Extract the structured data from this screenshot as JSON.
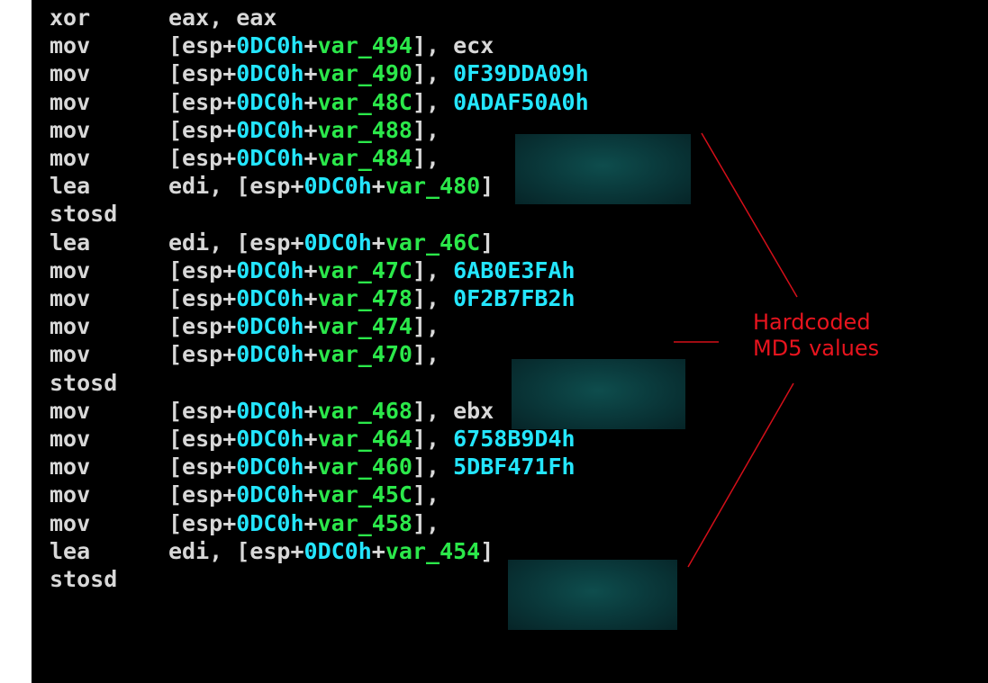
{
  "listing": {
    "lines": [
      {
        "mnemonic": "xor",
        "tokens": [
          {
            "t": "eax, eax",
            "k": "plain"
          }
        ]
      },
      {
        "mnemonic": "mov",
        "tokens": [
          {
            "t": "[esp+",
            "k": "plain"
          },
          {
            "t": "0DC0h",
            "k": "hex"
          },
          {
            "t": "+",
            "k": "plain"
          },
          {
            "t": "var_494",
            "k": "var"
          },
          {
            "t": "], ",
            "k": "plain"
          },
          {
            "t": "ecx",
            "k": "reg"
          }
        ]
      },
      {
        "mnemonic": "mov",
        "tokens": [
          {
            "t": "[esp+",
            "k": "plain"
          },
          {
            "t": "0DC0h",
            "k": "hex"
          },
          {
            "t": "+",
            "k": "plain"
          },
          {
            "t": "var_490",
            "k": "var"
          },
          {
            "t": "], ",
            "k": "plain"
          },
          {
            "t": "0F39DDA09h",
            "k": "imm"
          }
        ]
      },
      {
        "mnemonic": "mov",
        "tokens": [
          {
            "t": "[esp+",
            "k": "plain"
          },
          {
            "t": "0DC0h",
            "k": "hex"
          },
          {
            "t": "+",
            "k": "plain"
          },
          {
            "t": "var_48C",
            "k": "var"
          },
          {
            "t": "], ",
            "k": "plain"
          },
          {
            "t": "0ADAF50A0h",
            "k": "imm"
          }
        ]
      },
      {
        "mnemonic": "mov",
        "tokens": [
          {
            "t": "[esp+",
            "k": "plain"
          },
          {
            "t": "0DC0h",
            "k": "hex"
          },
          {
            "t": "+",
            "k": "plain"
          },
          {
            "t": "var_488",
            "k": "var"
          },
          {
            "t": "],",
            "k": "plain"
          }
        ]
      },
      {
        "mnemonic": "mov",
        "tokens": [
          {
            "t": "[esp+",
            "k": "plain"
          },
          {
            "t": "0DC0h",
            "k": "hex"
          },
          {
            "t": "+",
            "k": "plain"
          },
          {
            "t": "var_484",
            "k": "var"
          },
          {
            "t": "],",
            "k": "plain"
          }
        ]
      },
      {
        "mnemonic": "lea",
        "tokens": [
          {
            "t": "edi, [esp+",
            "k": "plain"
          },
          {
            "t": "0DC0h",
            "k": "hex"
          },
          {
            "t": "+",
            "k": "plain"
          },
          {
            "t": "var_480",
            "k": "var"
          },
          {
            "t": "]",
            "k": "plain"
          }
        ]
      },
      {
        "mnemonic": "stosd",
        "tokens": []
      },
      {
        "mnemonic": "lea",
        "tokens": [
          {
            "t": "edi, [esp+",
            "k": "plain"
          },
          {
            "t": "0DC0h",
            "k": "hex"
          },
          {
            "t": "+",
            "k": "plain"
          },
          {
            "t": "var_46C",
            "k": "var"
          },
          {
            "t": "]",
            "k": "plain"
          }
        ]
      },
      {
        "mnemonic": "mov",
        "tokens": [
          {
            "t": "[esp+",
            "k": "plain"
          },
          {
            "t": "0DC0h",
            "k": "hex"
          },
          {
            "t": "+",
            "k": "plain"
          },
          {
            "t": "var_47C",
            "k": "var"
          },
          {
            "t": "], ",
            "k": "plain"
          },
          {
            "t": "6AB0E3FAh",
            "k": "imm"
          }
        ]
      },
      {
        "mnemonic": "mov",
        "tokens": [
          {
            "t": "[esp+",
            "k": "plain"
          },
          {
            "t": "0DC0h",
            "k": "hex"
          },
          {
            "t": "+",
            "k": "plain"
          },
          {
            "t": "var_478",
            "k": "var"
          },
          {
            "t": "], ",
            "k": "plain"
          },
          {
            "t": "0F2B7FB2h",
            "k": "imm"
          }
        ]
      },
      {
        "mnemonic": "mov",
        "tokens": [
          {
            "t": "[esp+",
            "k": "plain"
          },
          {
            "t": "0DC0h",
            "k": "hex"
          },
          {
            "t": "+",
            "k": "plain"
          },
          {
            "t": "var_474",
            "k": "var"
          },
          {
            "t": "],",
            "k": "plain"
          }
        ]
      },
      {
        "mnemonic": "mov",
        "tokens": [
          {
            "t": "[esp+",
            "k": "plain"
          },
          {
            "t": "0DC0h",
            "k": "hex"
          },
          {
            "t": "+",
            "k": "plain"
          },
          {
            "t": "var_470",
            "k": "var"
          },
          {
            "t": "],",
            "k": "plain"
          }
        ]
      },
      {
        "mnemonic": "stosd",
        "tokens": []
      },
      {
        "mnemonic": "mov",
        "tokens": [
          {
            "t": "[esp+",
            "k": "plain"
          },
          {
            "t": "0DC0h",
            "k": "hex"
          },
          {
            "t": "+",
            "k": "plain"
          },
          {
            "t": "var_468",
            "k": "var"
          },
          {
            "t": "], ",
            "k": "plain"
          },
          {
            "t": "ebx",
            "k": "reg"
          }
        ]
      },
      {
        "mnemonic": "mov",
        "tokens": [
          {
            "t": "[esp+",
            "k": "plain"
          },
          {
            "t": "0DC0h",
            "k": "hex"
          },
          {
            "t": "+",
            "k": "plain"
          },
          {
            "t": "var_464",
            "k": "var"
          },
          {
            "t": "], ",
            "k": "plain"
          },
          {
            "t": "6758B9D4h",
            "k": "imm"
          }
        ]
      },
      {
        "mnemonic": "mov",
        "tokens": [
          {
            "t": "[esp+",
            "k": "plain"
          },
          {
            "t": "0DC0h",
            "k": "hex"
          },
          {
            "t": "+",
            "k": "plain"
          },
          {
            "t": "var_460",
            "k": "var"
          },
          {
            "t": "], ",
            "k": "plain"
          },
          {
            "t": "5DBF471Fh",
            "k": "imm"
          }
        ]
      },
      {
        "mnemonic": "mov",
        "tokens": [
          {
            "t": "[esp+",
            "k": "plain"
          },
          {
            "t": "0DC0h",
            "k": "hex"
          },
          {
            "t": "+",
            "k": "plain"
          },
          {
            "t": "var_45C",
            "k": "var"
          },
          {
            "t": "],",
            "k": "plain"
          }
        ]
      },
      {
        "mnemonic": "mov",
        "tokens": [
          {
            "t": "[esp+",
            "k": "plain"
          },
          {
            "t": "0DC0h",
            "k": "hex"
          },
          {
            "t": "+",
            "k": "plain"
          },
          {
            "t": "var_458",
            "k": "var"
          },
          {
            "t": "],",
            "k": "plain"
          }
        ]
      },
      {
        "mnemonic": "lea",
        "tokens": [
          {
            "t": "edi, [esp+",
            "k": "plain"
          },
          {
            "t": "0DC0h",
            "k": "hex"
          },
          {
            "t": "+",
            "k": "plain"
          },
          {
            "t": "var_454",
            "k": "var"
          },
          {
            "t": "]",
            "k": "plain"
          }
        ]
      },
      {
        "mnemonic": "stosd",
        "tokens": []
      }
    ]
  },
  "annotation": {
    "lines": [
      "Hardcoded",
      "MD5 values"
    ],
    "color": "#e8141e"
  },
  "colors": {
    "background": "#000000",
    "mnemonic": "#d8d8d8",
    "hex_constant": "#24e6ff",
    "variable": "#2be84a",
    "redaction": "#0e4d4d"
  }
}
